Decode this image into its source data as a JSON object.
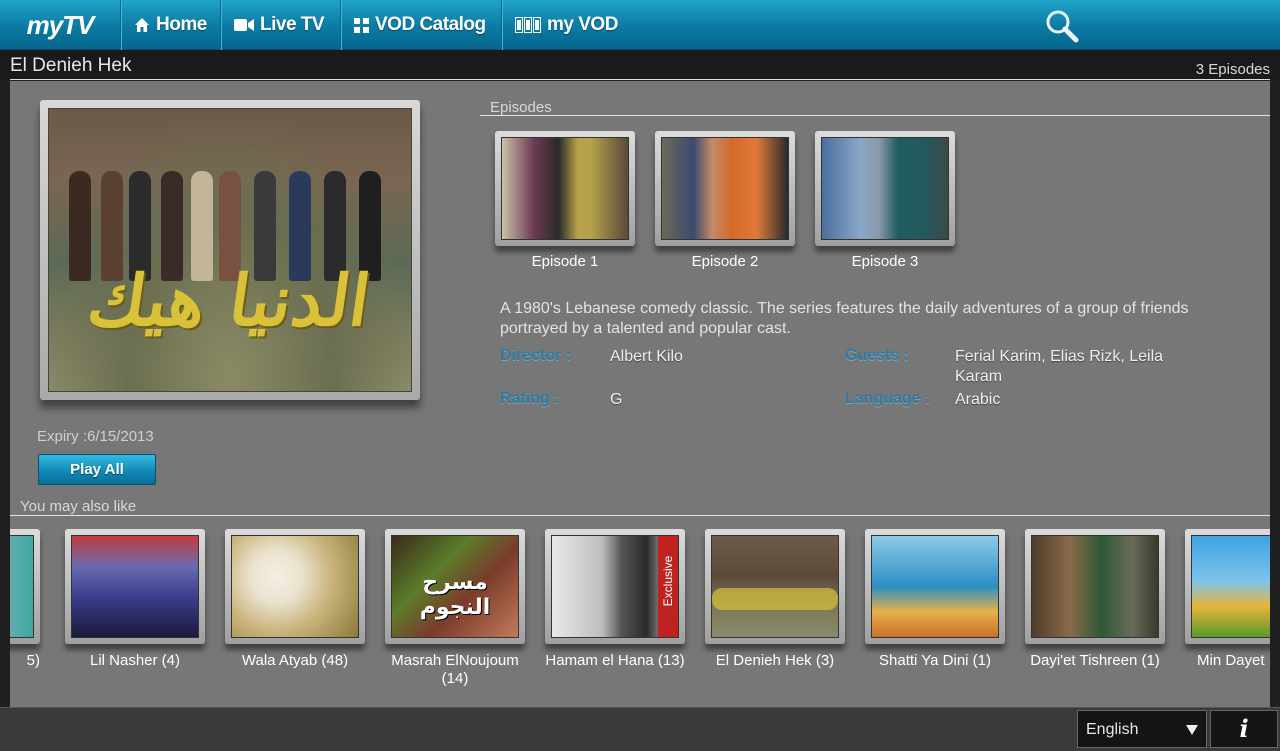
{
  "nav": {
    "logo": "myTV",
    "items": [
      {
        "label": "Home",
        "icon": "home-icon"
      },
      {
        "label": "Live TV",
        "icon": "video-camera-icon"
      },
      {
        "label": "VOD Catalog",
        "icon": "grid-icon"
      },
      {
        "label": "my VOD",
        "icon": "film-strip-icon"
      }
    ],
    "search_icon": "search-icon"
  },
  "show": {
    "title": "El Denieh Hek",
    "episode_count": "3 Episodes",
    "expiry": "Expiry :6/15/2013",
    "play_all": "Play All",
    "poster_text": "الدنيا هيك"
  },
  "episodes": {
    "label": "Episodes",
    "items": [
      {
        "label": "Episode 1",
        "colors": [
          "#6e3b55",
          "#b6a24a",
          "#c9c2a8"
        ]
      },
      {
        "label": "Episode 2",
        "colors": [
          "#3c4a6e",
          "#d46a2a",
          "#2a2a2a"
        ]
      },
      {
        "label": "Episode 3",
        "colors": [
          "#4a6f9e",
          "#1f5d63",
          "#8a9aa8"
        ]
      }
    ]
  },
  "details": {
    "description": "A 1980's Lebanese comedy classic. The series features the daily adventures of a group of friends portrayed by a talented and popular cast.",
    "director_key": "Director :",
    "director_val": "Albert Kilo",
    "guests_key": "Guests :",
    "guests_val": "Ferial Karim, Elias Rizk, Leila Karam",
    "rating_key": "Rating :",
    "rating_val": "G",
    "language_key": "Language :",
    "language_val": "Arabic"
  },
  "recommendations": {
    "label": "You may also like",
    "items": [
      {
        "label": "5)",
        "colors": [
          "#3ea7a3",
          "#b9cbd1"
        ]
      },
      {
        "label": "Lil Nasher (4)",
        "colors": [
          "#3a3f8c",
          "#c23b3b"
        ]
      },
      {
        "label": "Wala Atyab (48)",
        "colors": [
          "#c9b37a",
          "#eae3cf"
        ]
      },
      {
        "label": "Masrah ElNoujoum (14)",
        "colors": [
          "#5b7d2a",
          "#7a3b2b"
        ]
      },
      {
        "label": "Hamam el Hana (13)",
        "colors": [
          "#e9e9e9",
          "#2a2a2a"
        ]
      },
      {
        "label": "El Denieh Hek (3)",
        "colors": [
          "#6c5a4a",
          "#d9c23a"
        ]
      },
      {
        "label": "Shatti Ya Dini (1)",
        "colors": [
          "#2c8fc2",
          "#e7b14a"
        ]
      },
      {
        "label": "Dayi'et Tishreen (1)",
        "colors": [
          "#4e3d2c",
          "#2d5a35"
        ]
      },
      {
        "label": "Min Dayet",
        "colors": [
          "#3fa3e0",
          "#e6b43b"
        ]
      }
    ],
    "masrah_text": "مسرح النجوم",
    "exclusive_text": "Exclusive"
  },
  "footer": {
    "language": "English",
    "info_label": "i"
  }
}
